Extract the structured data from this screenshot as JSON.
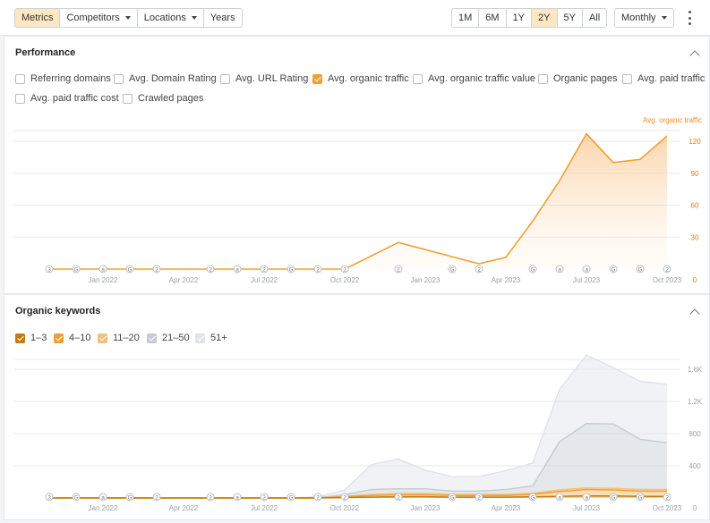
{
  "toolbar": {
    "left_tabs": [
      "Metrics",
      "Competitors",
      "Locations",
      "Years"
    ],
    "periods": [
      "1M",
      "6M",
      "1Y",
      "2Y",
      "5Y",
      "All"
    ],
    "active_period": "2Y",
    "granularity": "Monthly"
  },
  "performance": {
    "title": "Performance",
    "metrics": [
      {
        "label": "Referring domains",
        "checked": false
      },
      {
        "label": "Avg. Domain Rating",
        "checked": false
      },
      {
        "label": "Avg. URL Rating",
        "checked": false
      },
      {
        "label": "Avg. organic traffic",
        "checked": true
      },
      {
        "label": "Avg. organic traffic value",
        "checked": false
      },
      {
        "label": "Organic pages",
        "checked": false
      },
      {
        "label": "Avg. paid traffic",
        "checked": false
      },
      {
        "label": "Avg. paid traffic cost",
        "checked": false
      },
      {
        "label": "Crawled pages",
        "checked": false
      }
    ]
  },
  "keywords": {
    "title": "Organic keywords",
    "legend": [
      {
        "label": "1–3",
        "color": "#c97a10"
      },
      {
        "label": "4–10",
        "color": "#f0a030"
      },
      {
        "label": "11–20",
        "color": "#f5c07a"
      },
      {
        "label": "21–50",
        "color": "#c5cbd3"
      },
      {
        "label": "51+",
        "color": "#dfe3e8"
      }
    ]
  },
  "chart_data": [
    {
      "type": "area",
      "series": [
        {
          "name": "Avg. organic traffic",
          "color": "#f0a030",
          "points": [
            [
              "2021-11",
              0
            ],
            [
              "2021-12",
              0
            ],
            [
              "2022-01",
              0
            ],
            [
              "2022-02",
              0
            ],
            [
              "2022-03",
              0
            ],
            [
              "2022-04",
              0
            ],
            [
              "2022-05",
              0
            ],
            [
              "2022-06",
              0
            ],
            [
              "2022-07",
              0
            ],
            [
              "2022-08",
              0
            ],
            [
              "2022-09",
              0
            ],
            [
              "2022-10",
              0
            ],
            [
              "2022-12",
              25
            ],
            [
              "2023-03",
              5
            ],
            [
              "2023-04",
              11
            ],
            [
              "2023-05",
              45
            ],
            [
              "2023-06",
              83
            ],
            [
              "2023-07",
              127
            ],
            [
              "2023-08",
              100
            ],
            [
              "2023-09",
              103
            ],
            [
              "2023-10",
              125
            ]
          ]
        }
      ],
      "x_tick_labels": [
        "Jan 2022",
        "Apr 2022",
        "Jul 2022",
        "Oct 2022",
        "Jan 2023",
        "Apr 2023",
        "Jul 2023",
        "Oct 2023"
      ],
      "y_ticks": [
        0,
        30,
        60,
        90,
        120
      ],
      "y_tick_labels": [
        "0",
        "30",
        "60",
        "90",
        "120"
      ],
      "ylabel": "Avg. organic traffic",
      "ylim": [
        0,
        135
      ],
      "annotation_markers": [
        {
          "x": "2021-11",
          "label": "3"
        },
        {
          "x": "2021-12",
          "label": "G"
        },
        {
          "x": "2022-01",
          "label": "a"
        },
        {
          "x": "2022-02",
          "label": "G"
        },
        {
          "x": "2022-03",
          "label": "2"
        },
        {
          "x": "2022-05",
          "label": "2"
        },
        {
          "x": "2022-06",
          "label": "a"
        },
        {
          "x": "2022-07",
          "label": "2"
        },
        {
          "x": "2022-08",
          "label": "G"
        },
        {
          "x": "2022-09",
          "label": "2"
        },
        {
          "x": "2022-10",
          "label": "2"
        },
        {
          "x": "2022-12",
          "label": "2"
        },
        {
          "x": "2023-02",
          "label": "G"
        },
        {
          "x": "2023-03",
          "label": "2"
        },
        {
          "x": "2023-05",
          "label": "G"
        },
        {
          "x": "2023-06",
          "label": "a"
        },
        {
          "x": "2023-07",
          "label": "a"
        },
        {
          "x": "2023-08",
          "label": "G"
        },
        {
          "x": "2023-09",
          "label": "G"
        },
        {
          "x": "2023-10",
          "label": "2"
        }
      ]
    },
    {
      "type": "area",
      "stacked": true,
      "x": [
        "2021-11",
        "2021-12",
        "2022-01",
        "2022-02",
        "2022-03",
        "2022-04",
        "2022-05",
        "2022-06",
        "2022-07",
        "2022-08",
        "2022-09",
        "2022-10",
        "2022-11",
        "2022-12",
        "2023-01",
        "2023-02",
        "2023-03",
        "2023-04",
        "2023-05",
        "2023-06",
        "2023-07",
        "2023-08",
        "2023-09",
        "2023-10"
      ],
      "series": [
        {
          "name": "1–3",
          "color": "#c97a10",
          "values": [
            0,
            0,
            0,
            0,
            0,
            0,
            0,
            0,
            0,
            0,
            0,
            5,
            10,
            15,
            15,
            10,
            10,
            10,
            15,
            20,
            25,
            25,
            20,
            20
          ]
        },
        {
          "name": "4–10",
          "color": "#f0a030",
          "values": [
            0,
            0,
            0,
            0,
            0,
            0,
            0,
            0,
            0,
            0,
            0,
            10,
            20,
            25,
            25,
            20,
            20,
            20,
            30,
            60,
            80,
            75,
            65,
            65
          ]
        },
        {
          "name": "11–20",
          "color": "#f5c07a",
          "values": [
            0,
            0,
            0,
            0,
            0,
            0,
            0,
            0,
            0,
            0,
            0,
            5,
            15,
            15,
            15,
            15,
            15,
            15,
            15,
            20,
            20,
            20,
            20,
            20
          ]
        },
        {
          "name": "21–50",
          "color": "#c5cbd3",
          "values": [
            0,
            0,
            0,
            0,
            0,
            0,
            0,
            0,
            0,
            0,
            5,
            20,
            60,
            60,
            60,
            40,
            40,
            60,
            90,
            600,
            800,
            800,
            625,
            580
          ]
        },
        {
          "name": "51+",
          "color": "#dfe3e8",
          "values": [
            0,
            0,
            0,
            0,
            0,
            0,
            0,
            0,
            0,
            0,
            10,
            60,
            310,
            370,
            230,
            180,
            180,
            235,
            285,
            650,
            850,
            700,
            720,
            730
          ]
        }
      ],
      "x_tick_labels": [
        "Jan 2022",
        "Apr 2022",
        "Jul 2022",
        "Oct 2022",
        "Jan 2023",
        "Apr 2023",
        "Jul 2023",
        "Oct 2023"
      ],
      "y_ticks": [
        0,
        400,
        800,
        1200,
        1600
      ],
      "y_tick_labels": [
        "0",
        "400",
        "800",
        "1.2K",
        "1.6K"
      ],
      "ylim": [
        0,
        1800
      ],
      "annotation_markers": [
        {
          "x": "2021-11",
          "label": "3"
        },
        {
          "x": "2021-12",
          "label": "G"
        },
        {
          "x": "2022-01",
          "label": "a"
        },
        {
          "x": "2022-02",
          "label": "G"
        },
        {
          "x": "2022-03",
          "label": "2"
        },
        {
          "x": "2022-05",
          "label": "2"
        },
        {
          "x": "2022-06",
          "label": "a"
        },
        {
          "x": "2022-07",
          "label": "2"
        },
        {
          "x": "2022-08",
          "label": "G"
        },
        {
          "x": "2022-09",
          "label": "2"
        },
        {
          "x": "2022-10",
          "label": "2"
        },
        {
          "x": "2022-12",
          "label": "2"
        },
        {
          "x": "2023-02",
          "label": "G"
        },
        {
          "x": "2023-03",
          "label": "2"
        },
        {
          "x": "2023-05",
          "label": "G"
        },
        {
          "x": "2023-06",
          "label": "a"
        },
        {
          "x": "2023-07",
          "label": "a"
        },
        {
          "x": "2023-08",
          "label": "G"
        },
        {
          "x": "2023-09",
          "label": "G"
        },
        {
          "x": "2023-10",
          "label": "2"
        }
      ]
    }
  ]
}
